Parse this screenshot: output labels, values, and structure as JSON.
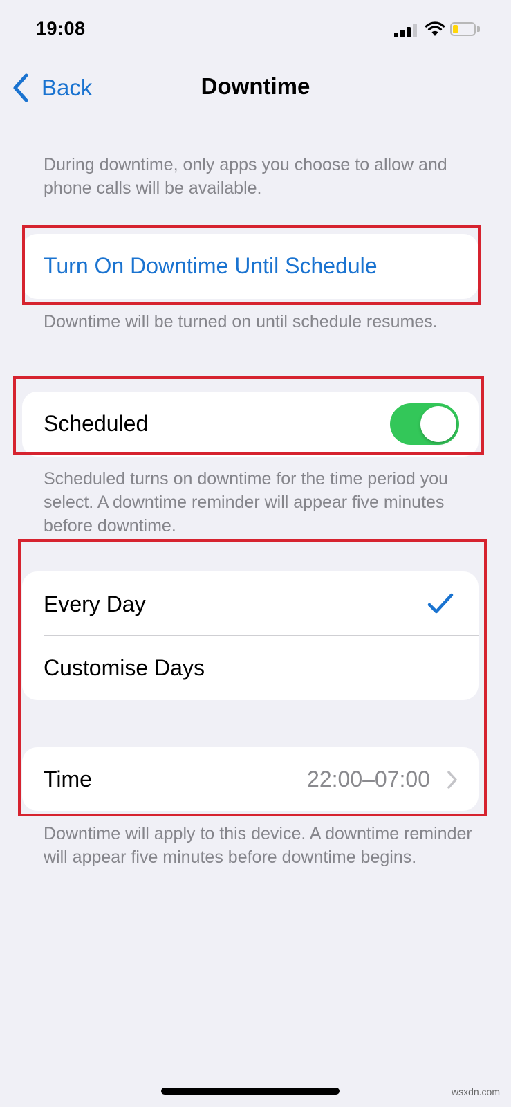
{
  "status_bar": {
    "time": "19:08",
    "icons": [
      "cellular-signal-icon",
      "wifi-icon",
      "battery-icon"
    ],
    "battery_level": 0.25
  },
  "nav": {
    "back_label": "Back",
    "title": "Downtime"
  },
  "intro_text": "During downtime, only apps you choose to allow and phone calls will be available.",
  "turn_on": {
    "label": "Turn On Downtime Until Schedule",
    "footer": "Downtime will be turned on until schedule resumes."
  },
  "scheduled": {
    "label": "Scheduled",
    "enabled": true,
    "footer": "Scheduled turns on downtime for the time period you select. A downtime reminder will appear five minutes before downtime."
  },
  "days": {
    "options": [
      {
        "label": "Every Day",
        "selected": true
      },
      {
        "label": "Customise Days",
        "selected": false
      }
    ]
  },
  "time": {
    "label": "Time",
    "value": "22:00–07:00"
  },
  "bottom_footer": "Downtime will apply to this device. A downtime reminder will appear five minutes before downtime begins.",
  "watermark": "wsxdn.com",
  "colors": {
    "accent": "#1a73d0",
    "toggle_on": "#33c759",
    "highlight": "#d6232f",
    "background": "#f0f0f6"
  }
}
